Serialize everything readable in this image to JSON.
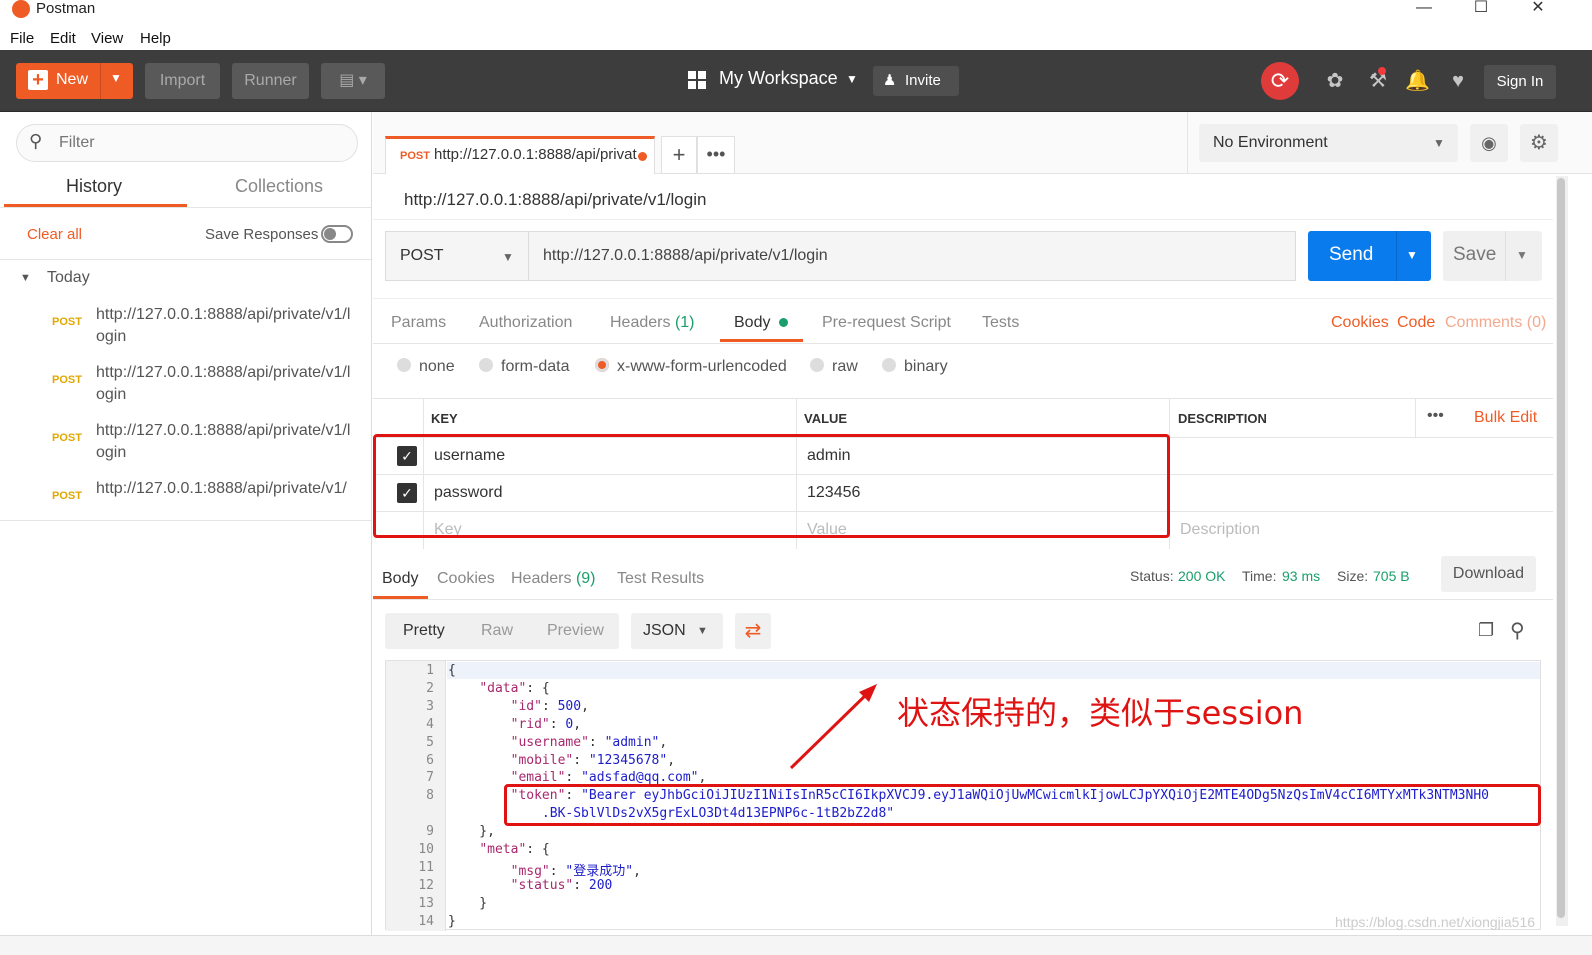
{
  "window": {
    "title": "Postman"
  },
  "menu": [
    "File",
    "Edit",
    "View",
    "Help"
  ],
  "toolbar": {
    "new_label": "New",
    "import_label": "Import",
    "runner_label": "Runner",
    "workspace_label": "My Workspace",
    "invite_label": "Invite",
    "signin_label": "Sign In"
  },
  "sidebar": {
    "filter_placeholder": "Filter",
    "tabs": [
      "History",
      "Collections"
    ],
    "clear_all": "Clear all",
    "save_responses": "Save Responses",
    "group_label": "Today",
    "history": [
      {
        "method": "POST",
        "url": "http://127.0.0.1:8888/api/private/v1/login"
      },
      {
        "method": "POST",
        "url": "http://127.0.0.1:8888/api/private/v1/login"
      },
      {
        "method": "POST",
        "url": "http://127.0.0.1:8888/api/private/v1/login"
      },
      {
        "method": "POST",
        "url": "http://127.0.0.1:8888/api/private/v1/"
      }
    ]
  },
  "request": {
    "tab_method": "POST",
    "tab_url": "http://127.0.0.1:8888/api/privat",
    "title": "http://127.0.0.1:8888/api/private/v1/login",
    "method": "POST",
    "url": "http://127.0.0.1:8888/api/private/v1/login",
    "send_label": "Send",
    "save_label": "Save",
    "environment": "No Environment",
    "subtabs": [
      "Params",
      "Authorization",
      "Headers",
      "Body",
      "Pre-request Script",
      "Tests"
    ],
    "headers_count": "(1)",
    "right_links": [
      "Cookies",
      "Code",
      "Comments (0)"
    ],
    "body_modes": [
      "none",
      "form-data",
      "x-www-form-urlencoded",
      "raw",
      "binary"
    ],
    "table": {
      "headers": [
        "KEY",
        "VALUE",
        "DESCRIPTION"
      ],
      "bulk_edit": "Bulk Edit",
      "rows": [
        {
          "key": "username",
          "value": "admin"
        },
        {
          "key": "password",
          "value": "123456"
        }
      ],
      "placeholder_key": "Key",
      "placeholder_value": "Value",
      "placeholder_desc": "Description"
    }
  },
  "response": {
    "tabs": [
      "Body",
      "Cookies",
      "Headers",
      "Test Results"
    ],
    "headers_count": "(9)",
    "status_label": "Status:",
    "status_value": "200 OK",
    "time_label": "Time:",
    "time_value": "93 ms",
    "size_label": "Size:",
    "size_value": "705 B",
    "download_label": "Download",
    "views": [
      "Pretty",
      "Raw",
      "Preview"
    ],
    "format": "JSON",
    "lines": [
      {
        "n": "1",
        "text": "{"
      },
      {
        "n": "2",
        "text": "    \"data\": {"
      },
      {
        "n": "3",
        "text": "        \"id\": 500,"
      },
      {
        "n": "4",
        "text": "        \"rid\": 0,"
      },
      {
        "n": "5",
        "text": "        \"username\": \"admin\","
      },
      {
        "n": "6",
        "text": "        \"mobile\": \"12345678\","
      },
      {
        "n": "7",
        "text": "        \"email\": \"adsfad@qq.com\","
      },
      {
        "n": "8",
        "text": "        \"token\": \"Bearer eyJhbGciOiJIUzI1NiIsInR5cCI6IkpXVCJ9.eyJ1aWQiOjUwMCwicmlkIjowLCJpYXQiOjE2MTE4ODg5NzQsImV4cCI6MTYxMTk3NTM3NH0"
      },
      {
        "n": "",
        "text": "            .BK-SblVlDs2vX5grExLO3Dt4d13EPNP6c-1tB2bZ2d8\""
      },
      {
        "n": "9",
        "text": "    },"
      },
      {
        "n": "10",
        "text": "    \"meta\": {"
      },
      {
        "n": "11",
        "text": "        \"msg\": \"登录成功\","
      },
      {
        "n": "12",
        "text": "        \"status\": 200"
      },
      {
        "n": "13",
        "text": "    }"
      },
      {
        "n": "14",
        "text": "}"
      }
    ]
  },
  "annotation": {
    "text": "状态保持的，类似于session"
  },
  "watermark": "https://blog.csdn.net/xiongjia516",
  "colors": {
    "accent": "#ef5b25",
    "send": "#097bed",
    "status_ok": "#1a9e6b",
    "annotation": "#e01313"
  }
}
